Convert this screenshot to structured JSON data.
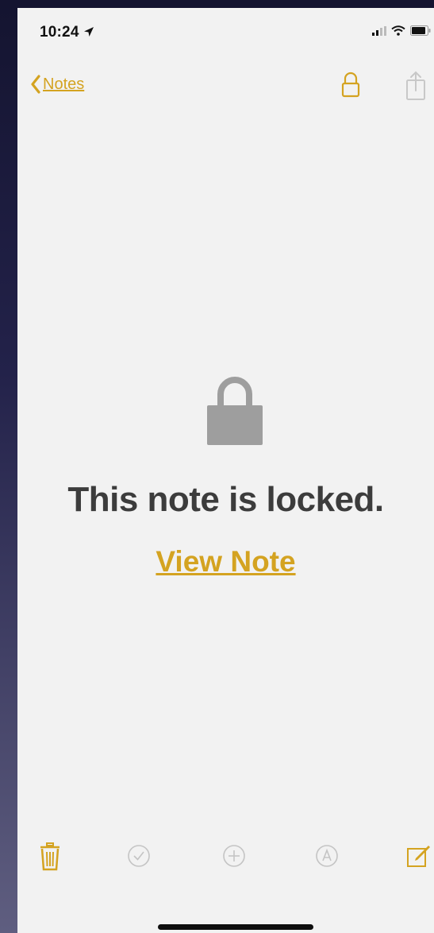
{
  "status_bar": {
    "time": "10:24",
    "icons": [
      "location-arrow-icon",
      "signal-icon",
      "wifi-icon",
      "battery-icon"
    ]
  },
  "nav": {
    "back_label": "Notes",
    "icons": [
      "chevron-left-icon",
      "lock-icon",
      "share-icon"
    ]
  },
  "content": {
    "locked_title": "This note is locked.",
    "view_note_label": "View Note"
  },
  "toolbar": {
    "icons": [
      "trash-icon",
      "checklist-icon",
      "add-icon",
      "markup-icon",
      "compose-icon"
    ]
  },
  "colors": {
    "accent": "#d4a321",
    "paper": "#f2f2f2",
    "title_text": "#3c3c3c",
    "lock_gray": "#9e9e9e",
    "toolbar_gray": "#c4c4c4"
  }
}
